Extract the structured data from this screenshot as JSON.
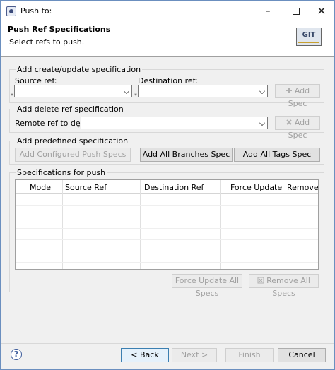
{
  "window": {
    "title": "Push to:",
    "minimize": "–",
    "close": "✕"
  },
  "banner": {
    "title": "Push Ref Specifications",
    "subtitle": "Select refs to push.",
    "logo_text": "GIT"
  },
  "create_section": {
    "title": "Add create/update specification",
    "source_label": "Source ref:",
    "source_value": "",
    "destination_label": "Destination ref:",
    "destination_value": "",
    "add_button": "Add Spec",
    "required_marker": "*"
  },
  "delete_section": {
    "title": "Add delete ref specification",
    "remote_label": "Remote ref to delete:",
    "remote_value": "",
    "add_button": "Add Spec",
    "required_marker": "*"
  },
  "predefined_section": {
    "title": "Add predefined specification",
    "configured_button": "Add Configured Push Specs",
    "branches_button": "Add All Branches Spec",
    "tags_button": "Add All Tags Spec"
  },
  "specs_section": {
    "title": "Specifications for push",
    "columns": [
      "Mode",
      "Source Ref",
      "Destination Ref",
      "Force Update",
      "Remove"
    ],
    "force_all_button": "Force Update All Specs",
    "remove_all_button": "Remove All Specs"
  },
  "footer": {
    "help": "?",
    "back": "< Back",
    "next": "Next >",
    "finish": "Finish",
    "cancel": "Cancel"
  }
}
